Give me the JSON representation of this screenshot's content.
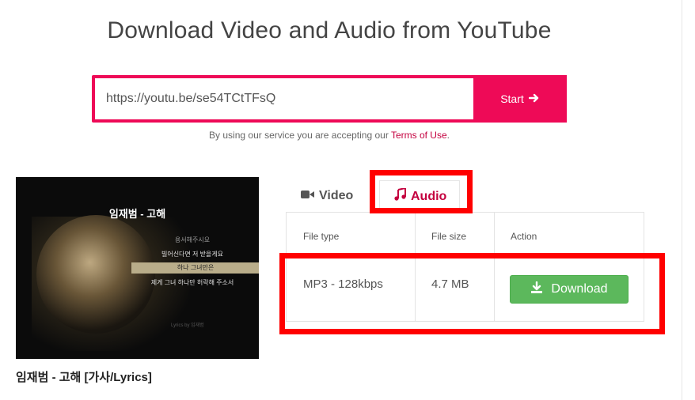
{
  "page_title": "Download Video and Audio from YouTube",
  "search": {
    "value": "https://youtu.be/se54TCtTFsQ",
    "start_label": "Start"
  },
  "terms": {
    "prefix": "By using our service you are accepting our ",
    "link": "Terms of Use",
    "suffix": "."
  },
  "thumbnail": {
    "title": "임재범 - 고해",
    "lyrics": [
      "용서해주시요",
      "빌어신다면 저 받을게요",
      "하나 그녀만은",
      "제게 그녀 하나만 허락해 주소서"
    ],
    "credit": "Lyrics by 임재범"
  },
  "video_caption": "임재범 - 고해 [가사/Lyrics]",
  "tabs": [
    {
      "label": "Video",
      "icon": "video-camera-icon",
      "active": false
    },
    {
      "label": "Audio",
      "icon": "music-note-icon",
      "active": true
    }
  ],
  "table": {
    "headers": [
      "File type",
      "File size",
      "Action"
    ],
    "rows": [
      {
        "type": "MP3 - 128kbps",
        "size": "4.7 MB",
        "action": "Download"
      }
    ]
  },
  "colors": {
    "brand": "#ee0a57",
    "link": "#c4003f",
    "download": "#5cb85c",
    "highlight": "#ff0000"
  }
}
